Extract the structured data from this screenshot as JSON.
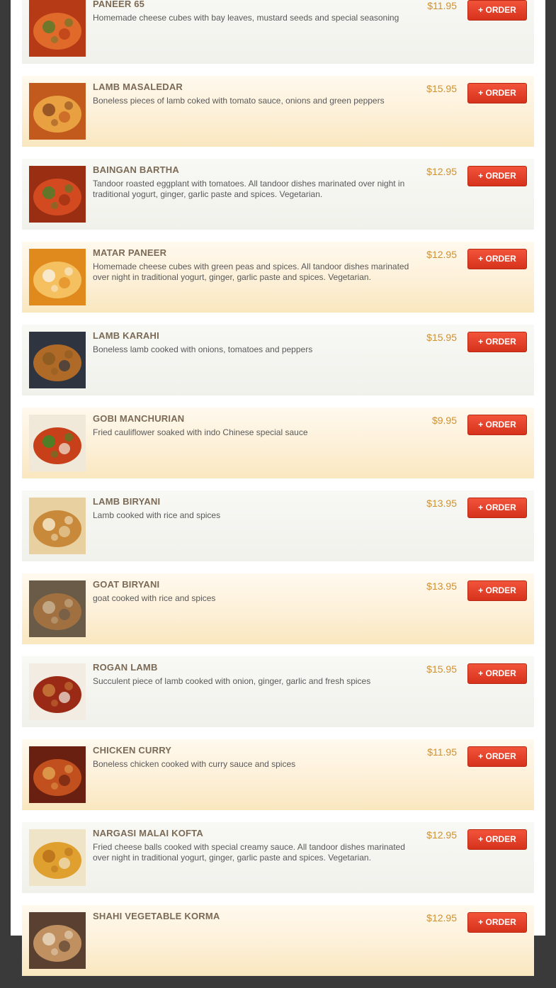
{
  "menu": {
    "items": [
      {
        "name": "PANEER 65",
        "description": "Homemade cheese cubes with bay leaves, mustard seeds and special seasoning",
        "price": "$11.95",
        "order_label": "+ ORDER",
        "image_colors": [
          "#b73a16",
          "#e06a2a",
          "#5a7a2a"
        ]
      },
      {
        "name": "LAMB MASALEDAR",
        "description": "Boneless pieces of lamb coked with tomato sauce, onions and green peppers",
        "price": "$15.95",
        "order_label": "+ ORDER",
        "image_colors": [
          "#c25a1e",
          "#e8a040",
          "#8a4a20"
        ]
      },
      {
        "name": "BAINGAN BARTHA",
        "description": "Tandoor roasted eggplant with tomatoes. All tandoor dishes marinated over night in traditional yogurt, ginger, garlic paste and spices. Vegetarian.",
        "price": "$12.95",
        "order_label": "+ ORDER",
        "image_colors": [
          "#9a2e12",
          "#d44a20",
          "#4d7d2a"
        ]
      },
      {
        "name": "MATAR PANEER",
        "description": "Homemade cheese cubes with green peas and spices. All tandoor dishes marinated over night in traditional yogurt, ginger, garlic paste and spices. Vegetarian.",
        "price": "$12.95",
        "order_label": "+ ORDER",
        "image_colors": [
          "#e08a1e",
          "#f4c060",
          "#f8f0e0"
        ]
      },
      {
        "name": "LAMB KARAHI",
        "description": "Boneless lamb cooked with onions, tomatoes and peppers",
        "price": "$15.95",
        "order_label": "+ ORDER",
        "image_colors": [
          "#2e3440",
          "#b06a28",
          "#8a5a20"
        ]
      },
      {
        "name": "GOBI MANCHURIAN",
        "description": "Fried cauliflower soaked with indo Chinese special sauce",
        "price": "$9.95",
        "order_label": "+ ORDER",
        "image_colors": [
          "#f0e8d8",
          "#c8401a",
          "#3a8a2a"
        ]
      },
      {
        "name": "LAMB BIRYANI",
        "description": "Lamb cooked with rice and spices",
        "price": "$13.95",
        "order_label": "+ ORDER",
        "image_colors": [
          "#e8d0a0",
          "#c88a3a",
          "#f4e6c8"
        ]
      },
      {
        "name": "GOAT BIRYANI",
        "description": "goat cooked with rice and spices",
        "price": "$13.95",
        "order_label": "+ ORDER",
        "image_colors": [
          "#6a5a48",
          "#a07040",
          "#c8b090"
        ]
      },
      {
        "name": "ROGAN LAMB",
        "description": "Succulent piece of lamb cooked with onion, ginger, garlic and fresh spices",
        "price": "$15.95",
        "order_label": "+ ORDER",
        "image_colors": [
          "#f2ece2",
          "#9a2a16",
          "#c87a3a"
        ]
      },
      {
        "name": "CHICKEN CURRY",
        "description": "Boneless chicken cooked with curry sauce and spices",
        "price": "$11.95",
        "order_label": "+ ORDER",
        "image_colors": [
          "#6a2010",
          "#c2501e",
          "#e0a050"
        ]
      },
      {
        "name": "NARGASI MALAI KOFTA",
        "description": "Fried cheese balls cooked with special creamy sauce. All tandoor dishes marinated over night in traditional yogurt, ginger, garlic paste and spices. Vegetarian.",
        "price": "$12.95",
        "order_label": "+ ORDER",
        "image_colors": [
          "#f0e4c8",
          "#e0a030",
          "#b8701a"
        ]
      },
      {
        "name": "SHAHI VEGETABLE KORMA",
        "description": "",
        "price": "$12.95",
        "order_label": "+ ORDER",
        "image_colors": [
          "#5a4030",
          "#c09060",
          "#e8d8c0"
        ]
      }
    ]
  }
}
